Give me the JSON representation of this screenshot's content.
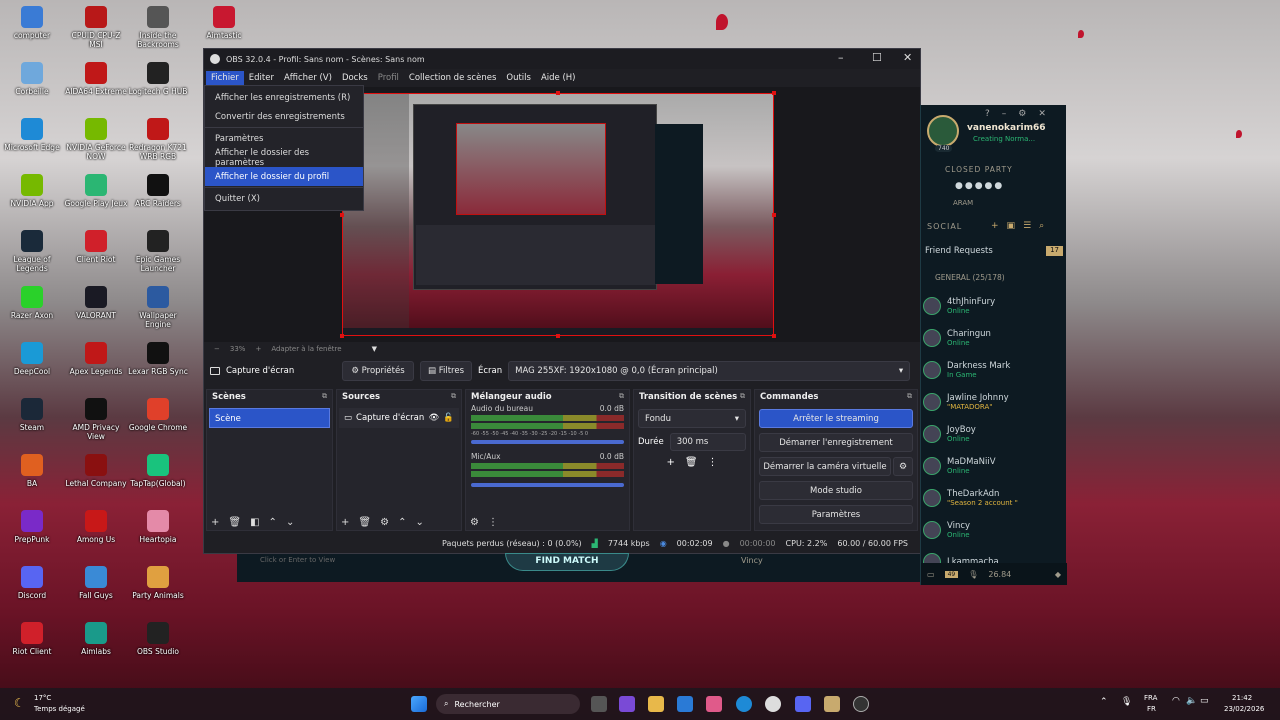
{
  "desktop": {
    "icons": [
      {
        "label": "computer",
        "color": "#3a7bd5"
      },
      {
        "label": "CPUID CPU-Z MSI",
        "color": "#b81818"
      },
      {
        "label": "Inside the Backrooms",
        "color": "#555"
      },
      {
        "label": "Aimtastic",
        "color": "#c81830"
      },
      {
        "label": "Corbeille",
        "color": "#6fa8dc"
      },
      {
        "label": "AIDA64 Extreme",
        "color": "#c01818"
      },
      {
        "label": "Logitech G HUB",
        "color": "#222"
      },
      {
        "label": "Microsoft Edge",
        "color": "#1e8ad6"
      },
      {
        "label": "NVIDIA GeForce NOW",
        "color": "#76b900"
      },
      {
        "label": "Redragon K721 WRB RGB",
        "color": "#c01818"
      },
      {
        "label": "NVIDIA App",
        "color": "#76b900"
      },
      {
        "label": "Google Play Jeux",
        "color": "#2bb673"
      },
      {
        "label": "ARC Raiders",
        "color": "#111"
      },
      {
        "label": "League of Legends",
        "color": "#1a2a3a"
      },
      {
        "label": "Client Riot",
        "color": "#d0202a"
      },
      {
        "label": "Epic Games Launcher",
        "color": "#222"
      },
      {
        "label": "Razer Axon",
        "color": "#2ad12a"
      },
      {
        "label": "VALORANT",
        "color": "#1a1a24"
      },
      {
        "label": "Wallpaper Engine",
        "color": "#2c5aa0"
      },
      {
        "label": "DeepCool",
        "color": "#1a9ad6"
      },
      {
        "label": "Apex Legends",
        "color": "#c01818"
      },
      {
        "label": "Lexar RGB Sync",
        "color": "#111"
      },
      {
        "label": "Steam",
        "color": "#1b2838"
      },
      {
        "label": "AMD Privacy View",
        "color": "#111"
      },
      {
        "label": "Google Chrome",
        "color": "#e0402a"
      },
      {
        "label": "BA",
        "color": "#e06020"
      },
      {
        "label": "Lethal Company",
        "color": "#8a1010"
      },
      {
        "label": "TapTap(Global)",
        "color": "#19c37d"
      },
      {
        "label": "PrepPunk",
        "color": "#7a2ac8"
      },
      {
        "label": "Among Us",
        "color": "#c81818"
      },
      {
        "label": "Heartopia",
        "color": "#e48aa8"
      },
      {
        "label": "Discord",
        "color": "#5865f2"
      },
      {
        "label": "Fall Guys",
        "color": "#3a8ad6"
      },
      {
        "label": "Party Animals",
        "color": "#e0a040"
      },
      {
        "label": "Riot Client",
        "color": "#d0202a"
      },
      {
        "label": "Aimlabs",
        "color": "#1a9a8a"
      },
      {
        "label": "OBS Studio",
        "color": "#222"
      }
    ]
  },
  "obs": {
    "title": "OBS 32.0.4 - Profil: Sans nom - Scènes: Sans nom",
    "menu": [
      "Fichier",
      "Editer",
      "Afficher (V)",
      "Docks",
      "Profil",
      "Collection de scènes",
      "Outils",
      "Aide (H)"
    ],
    "file_menu": [
      "Afficher les enregistrements (R)",
      "Convertir des enregistrements",
      "Paramètres",
      "Afficher le dossier des paramètres",
      "Afficher le dossier du profil",
      "Quitter (X)"
    ],
    "zoom": "33%",
    "zoom_fit": "Adapter à la fenêtre",
    "source_bar": {
      "source": "Capture d'écran",
      "properties": "Propriétés",
      "filters": "Filtres",
      "screen_label": "Écran",
      "screen_value": "MAG 255XF: 1920x1080 @ 0,0 (Écran principal)"
    },
    "scenes": {
      "title": "Scènes",
      "items": [
        "Scène"
      ]
    },
    "sources": {
      "title": "Sources",
      "items": [
        "Capture d'écran"
      ]
    },
    "mixer": {
      "title": "Mélangeur audio",
      "channels": [
        {
          "name": "Audio du bureau",
          "db": "0.0 dB",
          "level": 0.6
        },
        {
          "name": "Mic/Aux",
          "db": "0.0 dB",
          "level": 0.35
        }
      ],
      "scale": "-60 -55 -50 -45 -40 -35 -30 -25 -20 -15 -10 -5 0"
    },
    "transitions": {
      "title": "Transition de scènes",
      "type": "Fondu",
      "duration_label": "Durée",
      "duration": "300 ms"
    },
    "controls": {
      "title": "Commandes",
      "stop_streaming": "Arrêter le streaming",
      "start_recording": "Démarrer l'enregistrement",
      "start_virtual_cam": "Démarrer la caméra virtuelle",
      "studio_mode": "Mode studio",
      "settings": "Paramètres"
    },
    "status": {
      "dropped": "Paquets perdus (réseau) : 0 (0.0%)",
      "bitrate": "7744 kbps",
      "stream_time": "00:02:09",
      "rec_time": "00:00:00",
      "cpu": "CPU: 2.2%",
      "fps": "60.00 / 60.00 FPS"
    }
  },
  "lol": {
    "username": "vanenokarim66",
    "level": "740",
    "user_status": "Creating Norma...",
    "party_label": "CLOSED PARTY",
    "mode": "ARAM",
    "social": "SOCIAL",
    "friend_requests": "Friend Requests",
    "friend_requests_count": "17",
    "group": "GENERAL (25/178)",
    "friends": [
      {
        "name": "4thJhinFury",
        "status": "Online"
      },
      {
        "name": "Charingun",
        "status": "Online"
      },
      {
        "name": "Darkness Mark",
        "status": "In Game"
      },
      {
        "name": "Jawline Johnny",
        "status": "\"MATADORA\""
      },
      {
        "name": "JoyBoy",
        "status": "Online"
      },
      {
        "name": "MaDMaNiiV",
        "status": "Online"
      },
      {
        "name": "TheDarkAdn",
        "status": "\"Season 2 account \""
      },
      {
        "name": "Vincy",
        "status": "Online"
      },
      {
        "name": "Lkammacha",
        "status": ""
      }
    ],
    "chat_badge": "49",
    "bottom_count": "26.84",
    "find_match": "FIND MATCH",
    "invite": "Vincy",
    "click_enter": "Click or Enter to View"
  },
  "taskbar": {
    "weather_temp": "17°C",
    "weather_desc": "Temps dégagé",
    "search": "Rechercher",
    "lang": "FRA",
    "lang2": "FR",
    "time": "21:42",
    "date": "23/02/2026"
  }
}
